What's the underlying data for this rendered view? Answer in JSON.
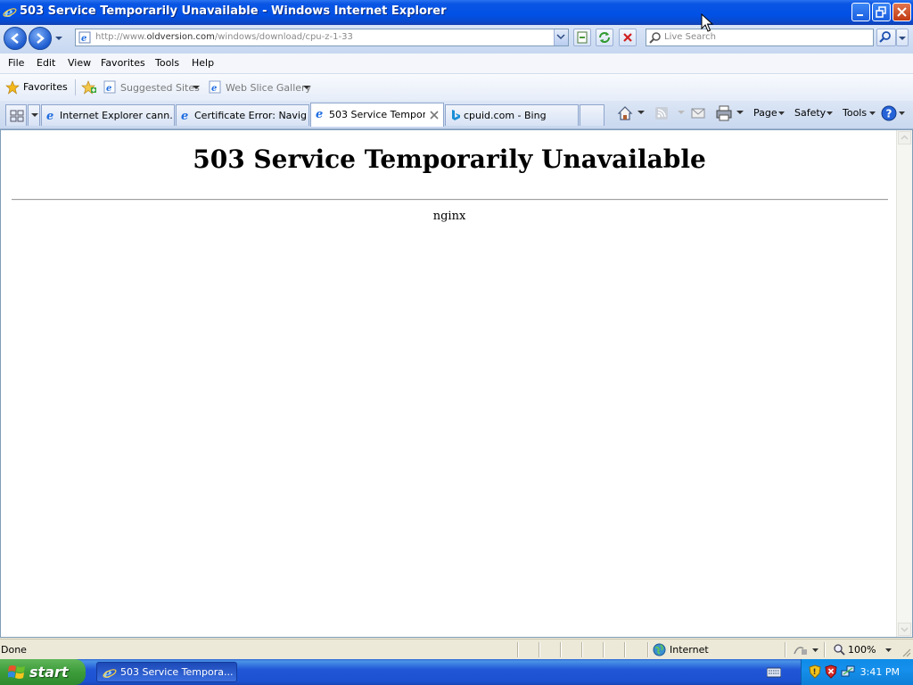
{
  "window": {
    "title": "503 Service Temporarily Unavailable - Windows Internet Explorer"
  },
  "address_bar": {
    "url_prefix": "http://www.",
    "url_domain": "oldversion.com",
    "url_path": "/windows/download/cpu-z-1-33"
  },
  "search": {
    "placeholder": "Live Search"
  },
  "menu": [
    "File",
    "Edit",
    "View",
    "Favorites",
    "Tools",
    "Help"
  ],
  "favorites_bar": {
    "favorites_label": "Favorites",
    "suggested_sites": "Suggested Sites",
    "web_slice_gallery": "Web Slice Gallery"
  },
  "tabs": [
    {
      "label": "Internet Explorer cann...",
      "active": false
    },
    {
      "label": "Certificate Error: Navig...",
      "active": false
    },
    {
      "label": "503 Service Tempor...",
      "active": true
    },
    {
      "label": "cpuid.com - Bing",
      "active": false
    }
  ],
  "command_bar": {
    "page": "Page",
    "safety": "Safety",
    "tools": "Tools"
  },
  "page": {
    "heading": "503 Service Temporarily Unavailable",
    "server": "nginx"
  },
  "status": {
    "text": "Done",
    "zone": "Internet",
    "zoom": "100%"
  },
  "taskbar": {
    "start": "start",
    "task_label": "503 Service Tempora...",
    "clock": "3:41 PM"
  },
  "colors": {
    "xp_blue": "#0151e6",
    "start_green": "#3d9c3a",
    "ie_blue": "#1d6ce0"
  }
}
